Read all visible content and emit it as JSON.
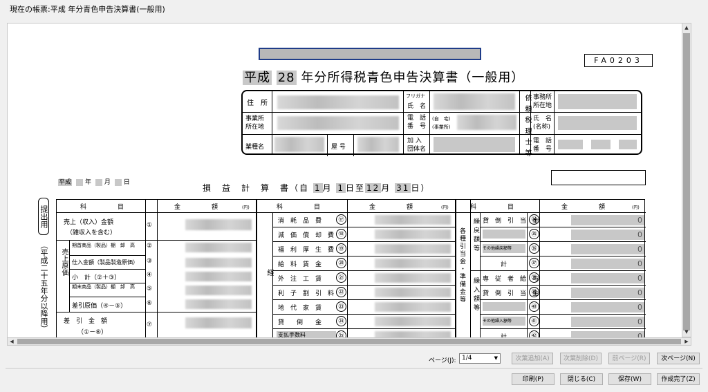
{
  "window": {
    "title": "現在の帳票:平成  年分青色申告決算書(一般用)"
  },
  "form": {
    "code": "FA0203",
    "title_era": "平成",
    "title_year": "28",
    "title_text": "年分所得税青色申告決算書（一般用）",
    "info": {
      "address": "住　所",
      "office_address": "事業所\n所在地",
      "business_type": "業種名",
      "shop_name": "屋 号",
      "furigana": "フリガナ",
      "name": "氏　名",
      "phone": "電　話\n番　号",
      "home": "(自　宅)",
      "office": "(事業所)",
      "association": "加 入\n団体名",
      "tax_accountant_label": "依頼税理士等",
      "office_loc": "事務所\n所在地",
      "ta_name": "氏　名\n(名称)",
      "ta_phone": "電　話\n番　号"
    },
    "period_prefix": "平成",
    "year_unit": "年",
    "month_unit": "月",
    "day_unit": "日",
    "pl_title": "損　益　計　算　書（",
    "pl_from": "自",
    "pl_from_m": "1",
    "pl_from_d": "1",
    "pl_to": "至",
    "pl_to_m": "12",
    "pl_to_d": "31",
    "pl_close": "）",
    "side_submit": "提出用",
    "side_note": "（平成二十五年分以降用）",
    "headers": {
      "item": "科　　　　　目",
      "amount": "金　　　　　額",
      "yen": "(円)"
    },
    "col1": [
      {
        "label": "売上（収入）金額",
        "sub": "（雑収入を含む）",
        "no": "①"
      },
      {
        "label": "期首商品（製品）棚　卸　高",
        "no": "②"
      },
      {
        "label": "仕入金額（製品製造原価）",
        "no": "③"
      },
      {
        "label": "小　計（②＋③）",
        "no": "④"
      },
      {
        "label": "期末商品（製品）棚　卸　高",
        "no": "⑤"
      },
      {
        "label": "差引原価（④－⑤）",
        "no": "⑥"
      },
      {
        "label": "差　引　金　額",
        "sub": "（①－⑥）",
        "no": "⑦"
      }
    ],
    "col1_group": "売上原価",
    "col2_group": "経",
    "col2": [
      {
        "label": "消　耗　品　費",
        "no": "⑰"
      },
      {
        "label": "減　価　償　却　費",
        "no": "⑱"
      },
      {
        "label": "福　利　厚　生　費",
        "no": "⑲"
      },
      {
        "label": "給　料　賃　金",
        "no": "⑳"
      },
      {
        "label": "外　注　工　賃",
        "no": "㉑"
      },
      {
        "label": "利　子　割　引　料",
        "no": "㉒"
      },
      {
        "label": "地　代　家　賃",
        "no": "㉓"
      },
      {
        "label": "貸　　倒　　金",
        "no": "㉔"
      },
      {
        "label": "支払手数料",
        "no": "㉕"
      }
    ],
    "col3_group_a": "各種引当金・準備金等",
    "col3_sub_a": "繰戻額等",
    "col3_sub_b": "繰入額等",
    "col3": [
      {
        "label": "貸　倒　引　当　金",
        "no": "㉞",
        "value": "0"
      },
      {
        "label": "",
        "no": "㉟",
        "value": "0"
      },
      {
        "label": "その他繰戻額等",
        "no": "㊱",
        "value": "0"
      },
      {
        "label": "計",
        "no": "㊲",
        "value": "0"
      },
      {
        "label": "専　従　者　給　与",
        "no": "㊳",
        "value": "0"
      },
      {
        "label": "貸　倒　引　当　金",
        "no": "㊴",
        "value": "0"
      },
      {
        "label": "",
        "no": "㊵",
        "value": "0"
      },
      {
        "label": "その他繰入額等",
        "no": "㊶",
        "value": "0"
      },
      {
        "label": "計",
        "no": "㊷",
        "value": "0"
      }
    ]
  },
  "footer": {
    "page_label": "ページ(J):",
    "page_value": "1/4",
    "add_page": "次葉追加(A)",
    "delete_page": "次葉削除(D)",
    "prev_page": "前ページ(R)",
    "next_page": "次ページ(N)",
    "print": "印刷(P)",
    "close": "閉じる(C)",
    "save": "保存(W)",
    "finish": "作成完了(Z)"
  }
}
